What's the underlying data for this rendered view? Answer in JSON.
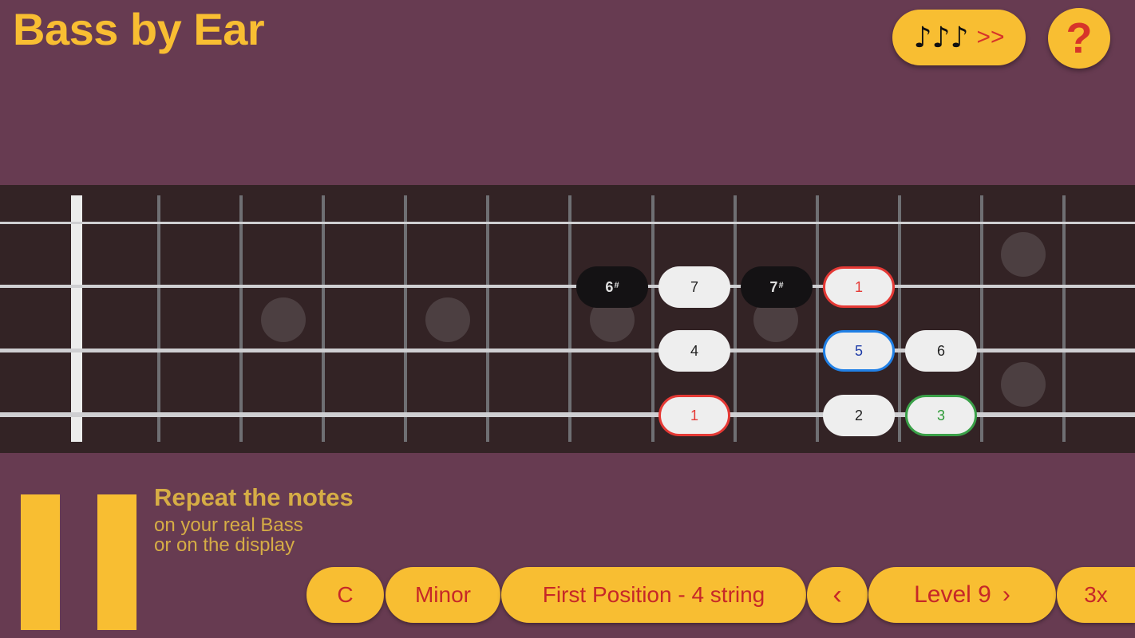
{
  "app": {
    "title": "Bass by Ear"
  },
  "header": {
    "play_button": {
      "icon": "music-notes-icon",
      "icon_glyph": "♪♪♪",
      "arrows": ">>"
    },
    "help_button": {
      "icon": "question-icon",
      "label": "?"
    }
  },
  "fretboard": {
    "colors": {
      "wood": "#332325",
      "inlay": "#4c3f41",
      "fret": "#6f6f73",
      "string": "#cfcfd2",
      "nut": "#ececec"
    },
    "notes": [
      {
        "label": "6",
        "accidental": "#",
        "style": "dark"
      },
      {
        "label": "7",
        "accidental": "",
        "style": "white"
      },
      {
        "label": "7",
        "accidental": "#",
        "style": "dark"
      },
      {
        "label": "1",
        "accidental": "",
        "style": "red"
      },
      {
        "label": "4",
        "accidental": "",
        "style": "white"
      },
      {
        "label": "5",
        "accidental": "",
        "style": "blue"
      },
      {
        "label": "6",
        "accidental": "",
        "style": "white"
      },
      {
        "label": "1",
        "accidental": "",
        "style": "red"
      },
      {
        "label": "2",
        "accidental": "",
        "style": "white"
      },
      {
        "label": "3",
        "accidental": "",
        "style": "green"
      }
    ]
  },
  "instructions": {
    "title": "Repeat the notes",
    "line1": "on your real Bass",
    "line2": "or on the display"
  },
  "pause_button": {
    "icon": "pause-icon"
  },
  "toolbar": {
    "key": "C",
    "scale": "Minor",
    "position": "First Position - 4 string",
    "prev_level": "‹",
    "level": "Level 9",
    "next_level": "›",
    "repeat": "3x"
  },
  "colors": {
    "background": "#673b51",
    "accent": "#f8be32",
    "accent_text": "#c62828",
    "title": "#f8be32"
  }
}
